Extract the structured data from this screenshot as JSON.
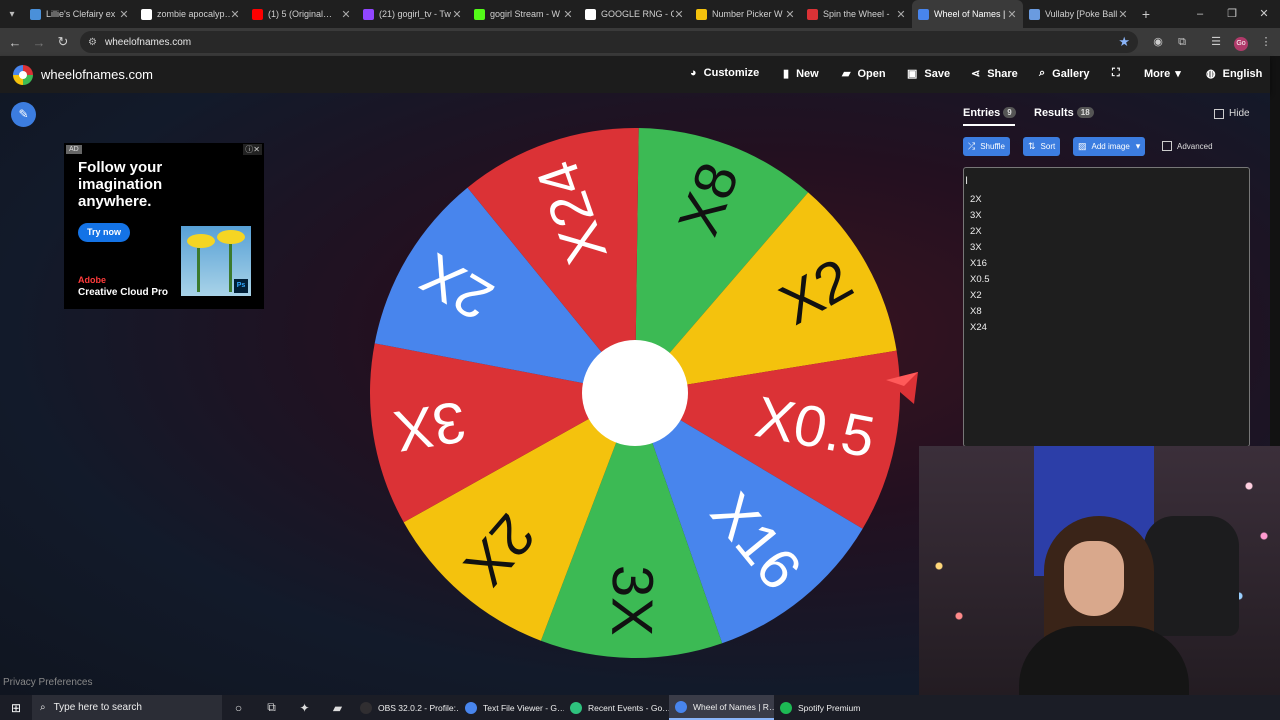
{
  "browser": {
    "tabs": [
      {
        "label": "Lillie's Clefairy ex",
        "color": "#4a90d9",
        "active": false
      },
      {
        "label": "zombie apocalyp…",
        "color": "#ffffff",
        "active": false
      },
      {
        "label": "(1) 5 (Original…",
        "color": "#ff0000",
        "active": false
      },
      {
        "label": "(21) gogirl_tv - Tw",
        "color": "#9146ff",
        "active": false
      },
      {
        "label": "gogirl Stream - W",
        "color": "#53fc18",
        "active": false
      },
      {
        "label": "GOOGLE RNG - G",
        "color": "#ffffff",
        "active": false
      },
      {
        "label": "Number Picker W",
        "color": "#f4c20d",
        "active": false
      },
      {
        "label": "Spin the Wheel -",
        "color": "#db3236",
        "active": false
      },
      {
        "label": "Wheel of Names |",
        "color": "#4885ed",
        "active": true
      },
      {
        "label": "Vullaby [Poke Ball",
        "color": "#6a9be0",
        "active": false
      }
    ],
    "url": "wheelofnames.com"
  },
  "site": {
    "name": "wheelofnames.com",
    "menu": {
      "customize": "Customize",
      "new": "New",
      "open": "Open",
      "save": "Save",
      "share": "Share",
      "gallery": "Gallery",
      "more": "More",
      "language": "English"
    }
  },
  "ad": {
    "tag": "AD",
    "headline": "Follow your imagination anywhere.",
    "cta": "Try now",
    "brand": "Adobe",
    "product": "Creative Cloud Pro",
    "badge": "Ps"
  },
  "wheel": {
    "colors": {
      "red": "#db3236",
      "green": "#3cba54",
      "yellow": "#f4c20d",
      "blue": "#4885ed"
    },
    "segments": [
      {
        "label": "X8",
        "color": "#3cba54"
      },
      {
        "label": "X2",
        "color": "#f4c20d"
      },
      {
        "label": "X0.5",
        "color": "#db3236"
      },
      {
        "label": "X16",
        "color": "#4885ed"
      },
      {
        "label": "3X",
        "color": "#3cba54"
      },
      {
        "label": "2X",
        "color": "#f4c20d"
      },
      {
        "label": "3X",
        "color": "#db3236"
      },
      {
        "label": "2X",
        "color": "#4885ed"
      },
      {
        "label": "X24",
        "color": "#db3236"
      }
    ]
  },
  "panel": {
    "entries_tab": "Entries",
    "entries_count": "9",
    "results_tab": "Results",
    "results_count": "18",
    "hide": "Hide",
    "shuffle": "Shuffle",
    "sort": "Sort",
    "add_image": "Add image",
    "advanced": "Advanced",
    "entries": [
      "2X",
      "3X",
      "2X",
      "3X",
      "X16",
      "X0.5",
      "X2",
      "X8",
      "X24"
    ]
  },
  "footer": {
    "privacy": "Privacy Preferences"
  },
  "taskbar": {
    "search_placeholder": "Type here to search",
    "apps": [
      {
        "label": "OBS 32.0.2 - Profile:…",
        "color": "#302e31",
        "active": false
      },
      {
        "label": "Text File Viewer - G…",
        "color": "#4885ed",
        "active": false
      },
      {
        "label": "Recent Events - Go…",
        "color": "#2ec27e",
        "active": false
      },
      {
        "label": "Wheel of Names | R…",
        "color": "#4885ed",
        "active": true
      },
      {
        "label": "Spotify Premium",
        "color": "#1db954",
        "active": false
      }
    ]
  }
}
